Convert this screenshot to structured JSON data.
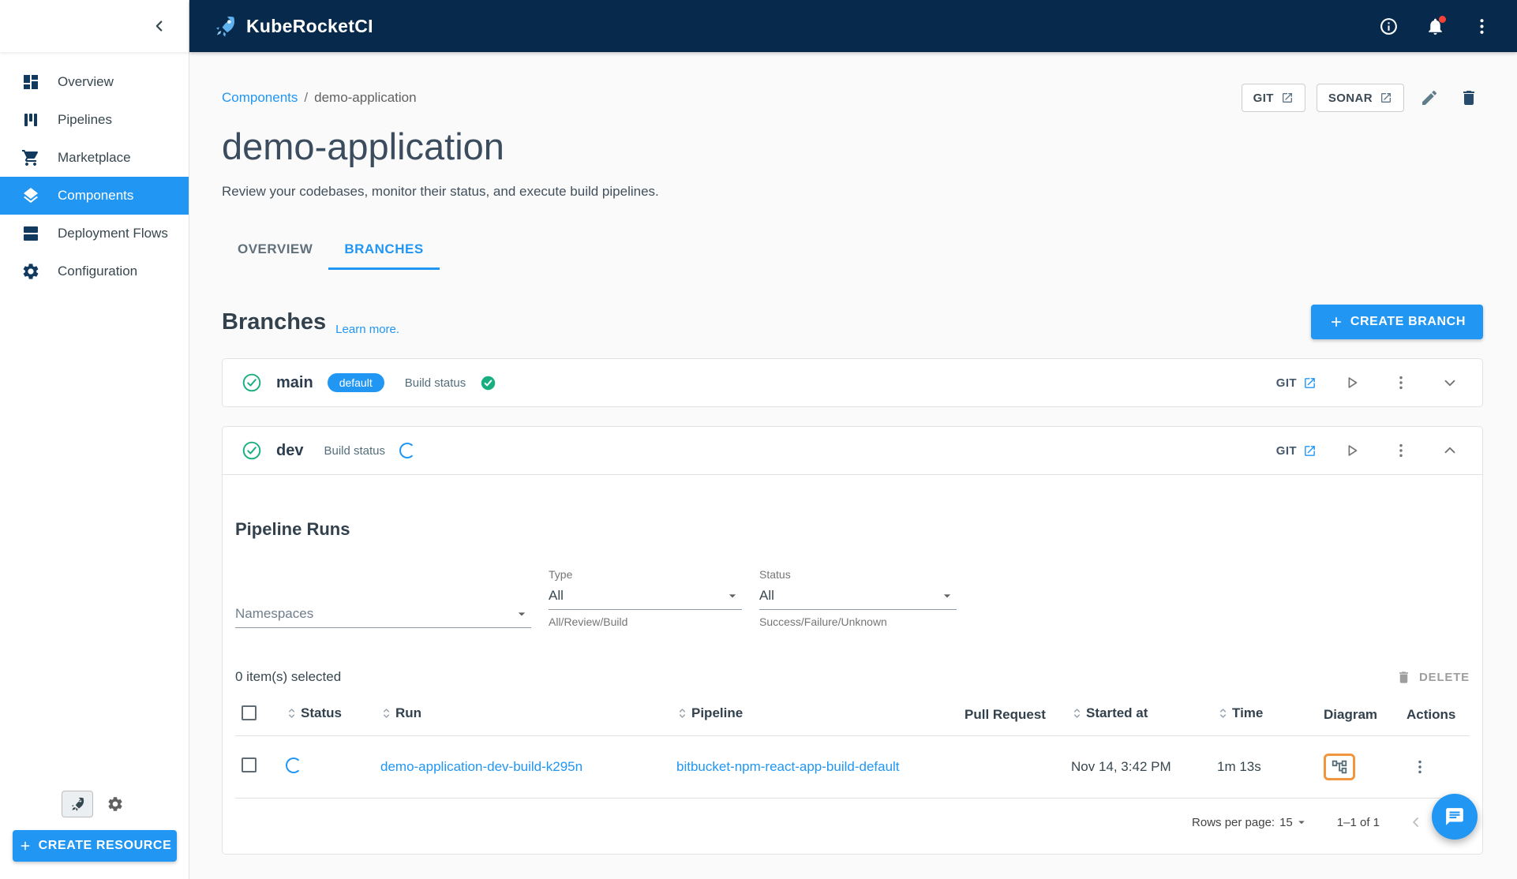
{
  "header": {
    "app_name": "KubeRocketCI"
  },
  "sidebar": {
    "items": [
      {
        "label": "Overview"
      },
      {
        "label": "Pipelines"
      },
      {
        "label": "Marketplace"
      },
      {
        "label": "Components"
      },
      {
        "label": "Deployment Flows"
      },
      {
        "label": "Configuration"
      }
    ],
    "create_resource_label": "CREATE RESOURCE"
  },
  "breadcrumb": {
    "parent": "Components",
    "separator": "/",
    "current": "demo-application"
  },
  "page": {
    "title": "demo-application",
    "subtitle": "Review your codebases, monitor their status, and execute build pipelines.",
    "git_button": "GIT",
    "sonar_button": "SONAR"
  },
  "tabs": {
    "overview": "OVERVIEW",
    "branches": "BRANCHES"
  },
  "branches": {
    "heading": "Branches",
    "learn_more": "Learn more.",
    "create_button": "CREATE BRANCH",
    "main": {
      "name": "main",
      "chip": "default",
      "build_status_label": "Build status",
      "git_label": "GIT"
    },
    "dev": {
      "name": "dev",
      "build_status_label": "Build status",
      "git_label": "GIT"
    }
  },
  "pipeline_runs": {
    "heading": "Pipeline Runs",
    "filters": {
      "namespaces_label": "Namespaces",
      "type_label": "Type",
      "type_value": "All",
      "type_helper": "All/Review/Build",
      "status_label": "Status",
      "status_value": "All",
      "status_helper": "Success/Failure/Unknown"
    },
    "selected_text": "0 item(s) selected",
    "delete_label": "DELETE",
    "columns": [
      "Status",
      "Run",
      "Pipeline",
      "Pull Request",
      "Started at",
      "Time",
      "Diagram",
      "Actions"
    ],
    "rows": [
      {
        "run": "demo-application-dev-build-k295n",
        "pipeline": "bitbucket-npm-react-app-build-default",
        "pull_request": "",
        "started_at": "Nov 14, 3:42 PM",
        "time": "1m 13s",
        "status": "running"
      }
    ],
    "pagination": {
      "rows_per_page_label": "Rows per page:",
      "rows_per_page_value": "15",
      "range_text": "1–1 of 1"
    }
  },
  "colors": {
    "primary": "#2196f3",
    "header_bg": "#072a4c",
    "success": "#18ae80",
    "highlight": "#f2953f"
  }
}
